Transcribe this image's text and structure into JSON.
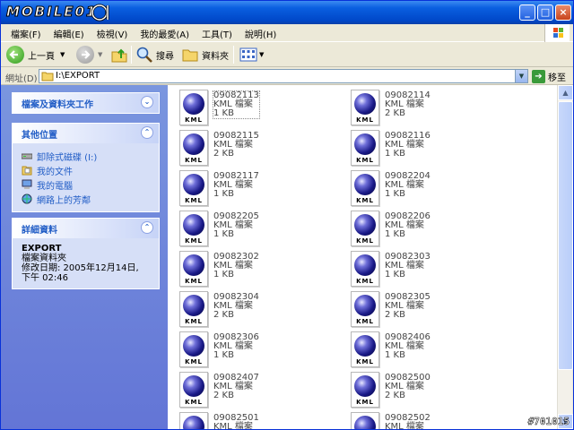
{
  "window": {
    "logo_text": "MOBILE01",
    "buttons": {
      "minimize": "_",
      "maximize": "□",
      "close": "×"
    }
  },
  "menu": [
    "檔案(F)",
    "編輯(E)",
    "檢視(V)",
    "我的最愛(A)",
    "工具(T)",
    "說明(H)"
  ],
  "toolbar": {
    "back_label": "上一頁",
    "search_label": "搜尋",
    "folders_label": "資料夾"
  },
  "address": {
    "label": "網址(D)",
    "value": "I:\\EXPORT",
    "go_label": "移至"
  },
  "sidebar": {
    "tasks_title": "檔案及資料夾工作",
    "places_title": "其他位置",
    "places": [
      {
        "label": "卸除式磁碟 (I:)",
        "icon": "removable-disk-icon"
      },
      {
        "label": "我的文件",
        "icon": "my-documents-icon"
      },
      {
        "label": "我的電腦",
        "icon": "my-computer-icon"
      },
      {
        "label": "網路上的芳鄰",
        "icon": "network-places-icon"
      }
    ],
    "details_title": "詳細資料",
    "details_name": "EXPORT",
    "details_type": "檔案資料夾",
    "details_modified": "修改日期: 2005年12月14日, 下午 02:46"
  },
  "files": [
    {
      "name": "09082113",
      "type": "KML 檔案",
      "size": "1 KB"
    },
    {
      "name": "09082114",
      "type": "KML 檔案",
      "size": "2 KB"
    },
    {
      "name": "09082115",
      "type": "KML 檔案",
      "size": "2 KB"
    },
    {
      "name": "09082116",
      "type": "KML 檔案",
      "size": "1 KB"
    },
    {
      "name": "09082117",
      "type": "KML 檔案",
      "size": "1 KB"
    },
    {
      "name": "09082204",
      "type": "KML 檔案",
      "size": "1 KB"
    },
    {
      "name": "09082205",
      "type": "KML 檔案",
      "size": "1 KB"
    },
    {
      "name": "09082206",
      "type": "KML 檔案",
      "size": "1 KB"
    },
    {
      "name": "09082302",
      "type": "KML 檔案",
      "size": "1 KB"
    },
    {
      "name": "09082303",
      "type": "KML 檔案",
      "size": "1 KB"
    },
    {
      "name": "09082304",
      "type": "KML 檔案",
      "size": "2 KB"
    },
    {
      "name": "09082305",
      "type": "KML 檔案",
      "size": "2 KB"
    },
    {
      "name": "09082306",
      "type": "KML 檔案",
      "size": "1 KB"
    },
    {
      "name": "09082406",
      "type": "KML 檔案",
      "size": "1 KB"
    },
    {
      "name": "09082407",
      "type": "KML 檔案",
      "size": "2 KB"
    },
    {
      "name": "09082500",
      "type": "KML 檔案",
      "size": "2 KB"
    },
    {
      "name": "09082501",
      "type": "KML 檔案",
      "size": ""
    },
    {
      "name": "09082502",
      "type": "KML 檔案",
      "size": ""
    }
  ],
  "kml_badge": "KML",
  "stamp": "#701015"
}
